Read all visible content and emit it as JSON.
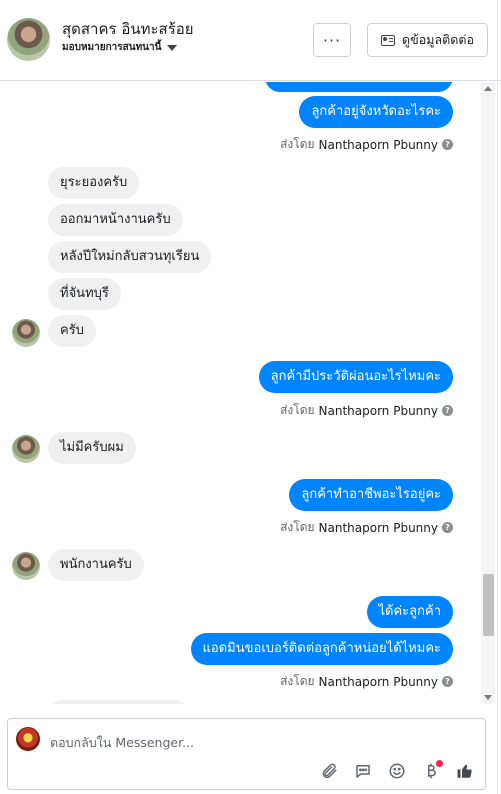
{
  "header": {
    "contact_name": "สุดสาคร อินทะสร้อย",
    "assignment": "มอบหมายการสนทนานี้",
    "more_label": "···",
    "contact_button_label": "ดูข้อมูลติดต่อ"
  },
  "messages": [
    {
      "dir": "out",
      "text": "",
      "partial": true
    },
    {
      "dir": "out",
      "text": "ลูกค้าอยู่จังหวัดอะไรคะ"
    },
    {
      "dir": "sent",
      "prefix": "ส่งโดย",
      "name": "Nanthaporn Pbunny"
    },
    {
      "dir": "in",
      "text": "ยุระยองครับ"
    },
    {
      "dir": "in",
      "text": "ออกมาหน้างานครับ"
    },
    {
      "dir": "in",
      "text": "หลังปีใหม่กลับสวนทุเรียน"
    },
    {
      "dir": "in",
      "text": "ที่จันทบุรี"
    },
    {
      "dir": "in",
      "text": "ครับ",
      "avatar": true
    },
    {
      "dir": "out",
      "text": "ลูกค้ามีประวัติผ่อนอะไรไหมคะ"
    },
    {
      "dir": "sent",
      "prefix": "ส่งโดย",
      "name": "Nanthaporn Pbunny"
    },
    {
      "dir": "in",
      "text": "ไม่มีครับผม",
      "avatar": true
    },
    {
      "dir": "out",
      "text": "ลูกค้าทำอาชีพอะไรอยู่คะ"
    },
    {
      "dir": "sent",
      "prefix": "ส่งโดย",
      "name": "Nanthaporn Pbunny"
    },
    {
      "dir": "in",
      "text": "พนักงานครับ",
      "avatar": true
    },
    {
      "dir": "out",
      "text": "ได้ค่ะลูกค้า"
    },
    {
      "dir": "out",
      "text": "แอดมินขอเบอร์ติดต่อลูกค้าหน่อยได้ไหมคะ"
    },
    {
      "dir": "sent",
      "prefix": "ส่งโดย",
      "name": "Nanthaporn Pbunny"
    }
  ],
  "composer": {
    "placeholder": "ตอบกลับใน Messenger..."
  },
  "icons": {
    "attach": "paperclip-icon",
    "saved_replies": "chat-bubble-icon",
    "emoji": "smiley-icon",
    "payment": "baht-icon",
    "like": "thumbs-up-icon"
  },
  "colors": {
    "outgoing_bubble": "#0084ff",
    "incoming_bubble": "#f0f0f0",
    "notification_dot": "#f02849"
  }
}
